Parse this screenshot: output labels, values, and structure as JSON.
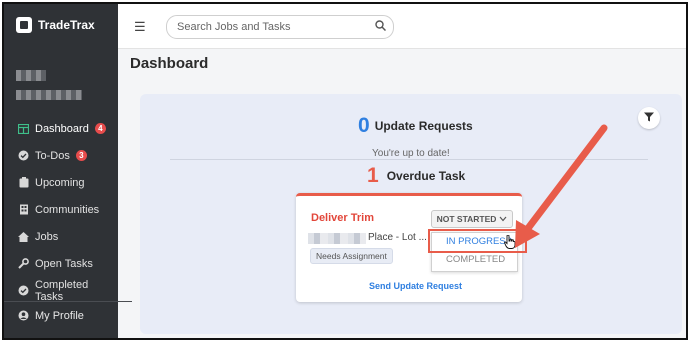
{
  "app": {
    "name": "TradeTrax"
  },
  "sidebar": {
    "items": [
      {
        "label": "Dashboard",
        "icon": "dashboard-icon",
        "badge": "4"
      },
      {
        "label": "To-Dos",
        "icon": "check-circle-icon",
        "badge": "3"
      },
      {
        "label": "Upcoming",
        "icon": "clipboard-icon"
      },
      {
        "label": "Communities",
        "icon": "building-icon"
      },
      {
        "label": "Jobs",
        "icon": "house-icon"
      },
      {
        "label": "Open Tasks",
        "icon": "wrench-icon"
      },
      {
        "label": "Completed Tasks",
        "icon": "check-circle-icon"
      }
    ],
    "profile_label": "My Profile"
  },
  "topbar": {
    "search_placeholder": "Search Jobs and Tasks"
  },
  "dashboard": {
    "title": "Dashboard",
    "update_requests": {
      "count": "0",
      "label": "Update Requests",
      "status": "You're up to date!"
    },
    "overdue": {
      "count": "1",
      "label": "Overdue Task"
    }
  },
  "task_card": {
    "title": "Deliver Trim",
    "address_suffix": "Place - Lot ...",
    "tag": "Needs Assignment",
    "status_value": "NOT STARTED",
    "status_options": [
      "IN PROGRESS",
      "COMPLETED"
    ],
    "send_update_label": "Send Update Request"
  },
  "colors": {
    "accent_blue": "#2f7fe0",
    "accent_red": "#e85c4a",
    "sidebar_bg": "#2f3236"
  }
}
